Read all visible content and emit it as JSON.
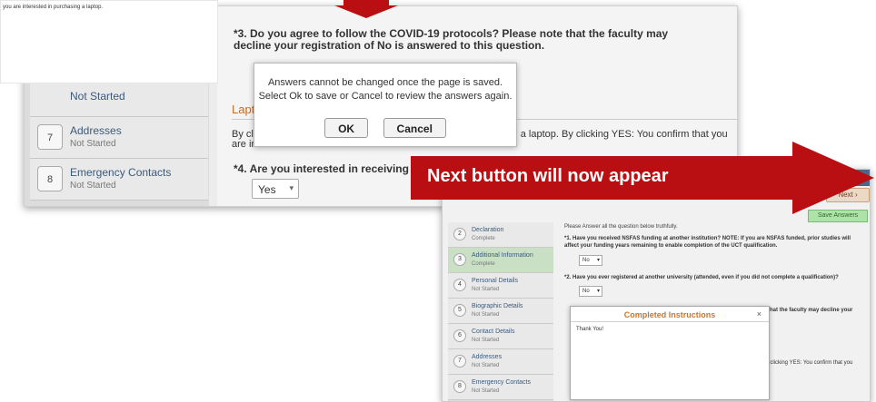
{
  "top_note": "you are interested in purchasing a laptop.",
  "main": {
    "question3": "*3. Do you agree to follow the COVID-19 protocols? Please note that the faculty may decline your registration of No is answered to this question.",
    "laptop_heading": "Lapt",
    "laptop_by_clicking_prefix": "By cli",
    "laptop_are_in": "are in",
    "laptop_rest": "ing a laptop. By clicking YES: You confirm that you",
    "question4": "*4. Are you interested in receiving a laptop from UCT?",
    "q4_value": "Yes",
    "steps": [
      {
        "number": "",
        "title": "",
        "status": "Not Started"
      },
      {
        "number": "7",
        "title": "Addresses",
        "status": "Not Started"
      },
      {
        "number": "8",
        "title": "Emergency Contacts",
        "status": "Not Started"
      }
    ],
    "dialog": {
      "message_line1": "Answers cannot be changed once the page is saved.",
      "message_line2": "Select Ok to save or Cancel to review the answers again.",
      "ok_label": "OK",
      "cancel_label": "Cancel"
    }
  },
  "banner": {
    "text": "Next button will now appear"
  },
  "second": {
    "next_label": "Next",
    "save_answers_label": "Save Answers",
    "please_text": "Please Answer all the question below truthfully.",
    "question1": "*1. Have you received NSFAS funding at another institution? NOTE: If you are NSFAS funded, prior studies will affect your funding years remaining to enable completion of the UCT qualification.",
    "q1_value": "No",
    "question2": "*2. Have you ever registered at another university (attended, even if you did not complete a qualification)?",
    "q2_value": "No",
    "question3_fragment": "that the faculty may decline your",
    "laptop_fragment": "laptop. By clicking YES: You confirm that you",
    "steps": [
      {
        "number": "2",
        "title": "Declaration",
        "status": "Complete"
      },
      {
        "number": "3",
        "title": "Additional Information",
        "status": "Complete"
      },
      {
        "number": "4",
        "title": "Personal Details",
        "status": "Not Started"
      },
      {
        "number": "5",
        "title": "Biographic Details",
        "status": "Not Started"
      },
      {
        "number": "6",
        "title": "Contact Details",
        "status": "Not Started"
      },
      {
        "number": "7",
        "title": "Addresses",
        "status": "Not Started"
      },
      {
        "number": "8",
        "title": "Emergency Contacts",
        "status": "Not Started"
      }
    ],
    "completed_dialog": {
      "title": "Completed Instructions",
      "close": "×",
      "body": "Thank You!"
    }
  },
  "colors": {
    "arrow_red": "#b90f12",
    "heading_orange": "#c66a1e",
    "nav_blue": "#4a6889"
  }
}
